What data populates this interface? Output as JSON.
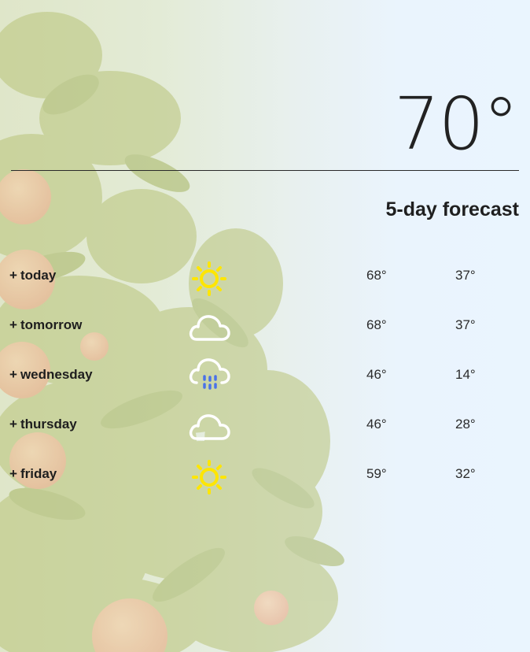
{
  "current": {
    "temperature": "70°"
  },
  "forecast": {
    "title": "5-day forecast",
    "days": [
      {
        "label": "today",
        "icon": "sun-icon",
        "high": "68°",
        "low": "37°"
      },
      {
        "label": "tomorrow",
        "icon": "cloud-icon",
        "high": "68°",
        "low": "37°"
      },
      {
        "label": "wednesday",
        "icon": "rain-cloud-icon",
        "high": "46°",
        "low": "14°"
      },
      {
        "label": "thursday",
        "icon": "cloud-icon",
        "high": "46°",
        "low": "28°"
      },
      {
        "label": "friday",
        "icon": "sun-icon",
        "high": "59°",
        "low": "32°"
      }
    ],
    "expand_symbol": "+"
  },
  "colors": {
    "sun": "#ffe600",
    "rain": "#4a72e8",
    "cloud_stroke": "#ffffff",
    "text": "#1e1e1e"
  }
}
